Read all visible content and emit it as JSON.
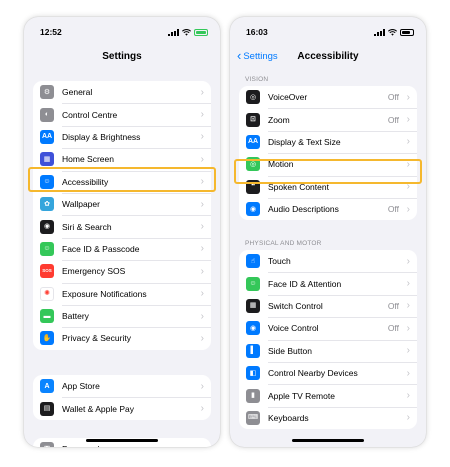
{
  "left": {
    "status_time": "12:52",
    "title": "Settings",
    "groups": [
      [
        {
          "label": "General",
          "icon": "gear-icon",
          "color": "#8e8e93",
          "glyph": "⚙"
        },
        {
          "label": "Control Centre",
          "icon": "toggles-icon",
          "color": "#8e8e93",
          "glyph": "◐"
        },
        {
          "label": "Display & Brightness",
          "icon": "text-size-icon",
          "color": "#007aff",
          "glyph": "AA"
        },
        {
          "label": "Home Screen",
          "icon": "grid-icon",
          "color": "#3f51d9",
          "glyph": "▦"
        },
        {
          "label": "Accessibility",
          "icon": "accessibility-icon",
          "color": "#007aff",
          "glyph": "☺"
        },
        {
          "label": "Wallpaper",
          "icon": "flower-icon",
          "color": "#35a5dc",
          "glyph": "✿"
        },
        {
          "label": "Siri & Search",
          "icon": "siri-icon",
          "color": "#1c1c1e",
          "glyph": "◉"
        },
        {
          "label": "Face ID & Passcode",
          "icon": "face-id-icon",
          "color": "#34c759",
          "glyph": "☺"
        },
        {
          "label": "Emergency SOS",
          "icon": "sos-icon",
          "color": "#ff3b30",
          "glyph": "SOS"
        },
        {
          "label": "Exposure Notifications",
          "icon": "exposure-icon",
          "color": "#ffffff",
          "glyph": "✺"
        },
        {
          "label": "Battery",
          "icon": "battery-icon",
          "color": "#34c759",
          "glyph": "▬"
        },
        {
          "label": "Privacy & Security",
          "icon": "hand-icon",
          "color": "#007aff",
          "glyph": "✋"
        }
      ],
      [
        {
          "label": "App Store",
          "icon": "app-store-icon",
          "color": "#0a84ff",
          "glyph": "A"
        },
        {
          "label": "Wallet & Apple Pay",
          "icon": "wallet-icon",
          "color": "#1c1c1e",
          "glyph": "▤"
        }
      ],
      [
        {
          "label": "Passwords",
          "icon": "key-icon",
          "color": "#8e8e93",
          "glyph": "⚿"
        }
      ]
    ]
  },
  "right": {
    "status_time": "16:03",
    "back_label": "Settings",
    "title": "Accessibility",
    "vision_header": "VISION",
    "vision": [
      {
        "label": "VoiceOver",
        "value": "Off",
        "icon": "voiceover-icon",
        "color": "#1c1c1e",
        "glyph": "◎"
      },
      {
        "label": "Zoom",
        "value": "Off",
        "icon": "zoom-icon",
        "color": "#1c1c1e",
        "glyph": "⊡"
      },
      {
        "label": "Display & Text Size",
        "value": "",
        "icon": "text-size-icon",
        "color": "#007aff",
        "glyph": "AA"
      },
      {
        "label": "Motion",
        "value": "",
        "icon": "motion-icon",
        "color": "#34c759",
        "glyph": "◎"
      },
      {
        "label": "Spoken Content",
        "value": "",
        "icon": "speech-bubble-icon",
        "color": "#1c1c1e",
        "glyph": "❝"
      },
      {
        "label": "Audio Descriptions",
        "value": "Off",
        "icon": "audio-description-icon",
        "color": "#007aff",
        "glyph": "◉"
      }
    ],
    "motor_header": "PHYSICAL AND MOTOR",
    "motor": [
      {
        "label": "Touch",
        "value": "",
        "icon": "touch-hand-icon",
        "color": "#007aff",
        "glyph": "☝"
      },
      {
        "label": "Face ID & Attention",
        "value": "",
        "icon": "face-id-icon",
        "color": "#34c759",
        "glyph": "☺"
      },
      {
        "label": "Switch Control",
        "value": "Off",
        "icon": "switch-control-icon",
        "color": "#1c1c1e",
        "glyph": "▦"
      },
      {
        "label": "Voice Control",
        "value": "Off",
        "icon": "voice-control-icon",
        "color": "#007aff",
        "glyph": "◉"
      },
      {
        "label": "Side Button",
        "value": "",
        "icon": "side-button-icon",
        "color": "#007aff",
        "glyph": "▌"
      },
      {
        "label": "Control Nearby Devices",
        "value": "",
        "icon": "nearby-devices-icon",
        "color": "#007aff",
        "glyph": "◧"
      },
      {
        "label": "Apple TV Remote",
        "value": "",
        "icon": "remote-icon",
        "color": "#8e8e93",
        "glyph": "▮"
      },
      {
        "label": "Keyboards",
        "value": "",
        "icon": "keyboard-icon",
        "color": "#8e8e93",
        "glyph": "⌨"
      }
    ]
  },
  "highlight_color": "#f5b82e"
}
